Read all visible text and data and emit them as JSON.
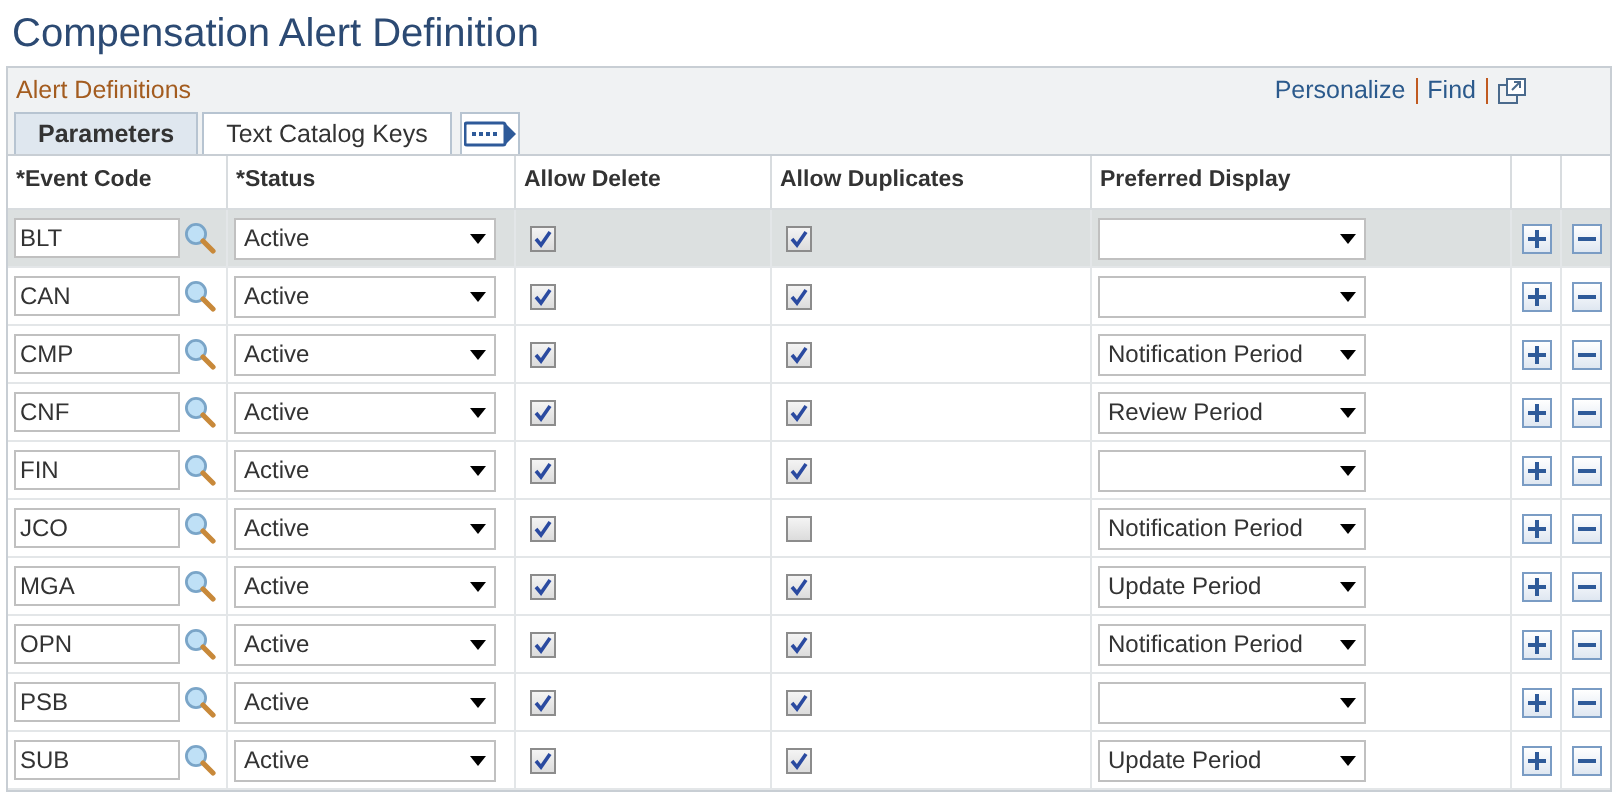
{
  "page_title": "Compensation Alert Definition",
  "grid": {
    "title": "Alert Definitions",
    "links": [
      "Personalize",
      "Find"
    ],
    "tabs": [
      {
        "label": "Parameters",
        "selected": true
      },
      {
        "label": "Text Catalog Keys",
        "selected": false
      }
    ],
    "columns": [
      "*Event Code",
      "*Status",
      "Allow Delete",
      "Allow Duplicates",
      "Preferred Display"
    ],
    "rows": [
      {
        "event_code": "BLT",
        "status": "Active",
        "allow_delete": true,
        "allow_duplicates": true,
        "preferred_display": "",
        "selected": true
      },
      {
        "event_code": "CAN",
        "status": "Active",
        "allow_delete": true,
        "allow_duplicates": true,
        "preferred_display": "",
        "selected": false
      },
      {
        "event_code": "CMP",
        "status": "Active",
        "allow_delete": true,
        "allow_duplicates": true,
        "preferred_display": "Notification Period",
        "selected": false
      },
      {
        "event_code": "CNF",
        "status": "Active",
        "allow_delete": true,
        "allow_duplicates": true,
        "preferred_display": "Review Period",
        "selected": false
      },
      {
        "event_code": "FIN",
        "status": "Active",
        "allow_delete": true,
        "allow_duplicates": true,
        "preferred_display": "",
        "selected": false
      },
      {
        "event_code": "JCO",
        "status": "Active",
        "allow_delete": true,
        "allow_duplicates": false,
        "preferred_display": "Notification Period",
        "selected": false
      },
      {
        "event_code": "MGA",
        "status": "Active",
        "allow_delete": true,
        "allow_duplicates": true,
        "preferred_display": "Update Period",
        "selected": false
      },
      {
        "event_code": "OPN",
        "status": "Active",
        "allow_delete": true,
        "allow_duplicates": true,
        "preferred_display": "Notification Period",
        "selected": false
      },
      {
        "event_code": "PSB",
        "status": "Active",
        "allow_delete": true,
        "allow_duplicates": true,
        "preferred_display": "",
        "selected": false
      },
      {
        "event_code": "SUB",
        "status": "Active",
        "allow_delete": true,
        "allow_duplicates": true,
        "preferred_display": "Update Period",
        "selected": false
      }
    ]
  }
}
